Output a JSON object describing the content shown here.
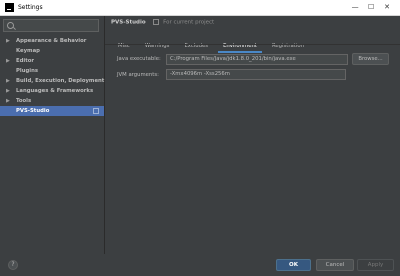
{
  "window": {
    "title": "Settings",
    "controls": [
      "—",
      "☐",
      "✕"
    ]
  },
  "sidebar": {
    "search_placeholder": "",
    "items": [
      {
        "label": "Appearance & Behavior",
        "expandable": true
      },
      {
        "label": "Keymap",
        "expandable": false
      },
      {
        "label": "Editor",
        "expandable": true
      },
      {
        "label": "Plugins",
        "expandable": false
      },
      {
        "label": "Build, Execution, Deployment",
        "expandable": true
      },
      {
        "label": "Languages & Frameworks",
        "expandable": true
      },
      {
        "label": "Tools",
        "expandable": true
      },
      {
        "label": "PVS-Studio",
        "expandable": false,
        "selected": true
      }
    ]
  },
  "header": {
    "section": "PVS-Studio",
    "scope": "For current project"
  },
  "tabs": [
    {
      "label": "Misc",
      "active": false
    },
    {
      "label": "Warnings",
      "active": false
    },
    {
      "label": "Excludes",
      "active": false
    },
    {
      "label": "Environment",
      "active": true
    },
    {
      "label": "Registration",
      "active": false
    }
  ],
  "environment": {
    "java_label": "Java executable:",
    "java_value": "C:/Program Files/Java/jdk1.8.0_201/bin/java.exe",
    "browse_label": "Browse...",
    "jvm_label": "JVM arguments:",
    "jvm_value": "-Xmx4096m -Xss256m"
  },
  "footer": {
    "help_label": "?",
    "ok_label": "OK",
    "cancel_label": "Cancel",
    "apply_label": "Apply"
  },
  "colors": {
    "background": "#3c3f41",
    "selection": "#4b6eaf",
    "primary_button": "#365880",
    "tab_underline": "#4a88c7"
  }
}
